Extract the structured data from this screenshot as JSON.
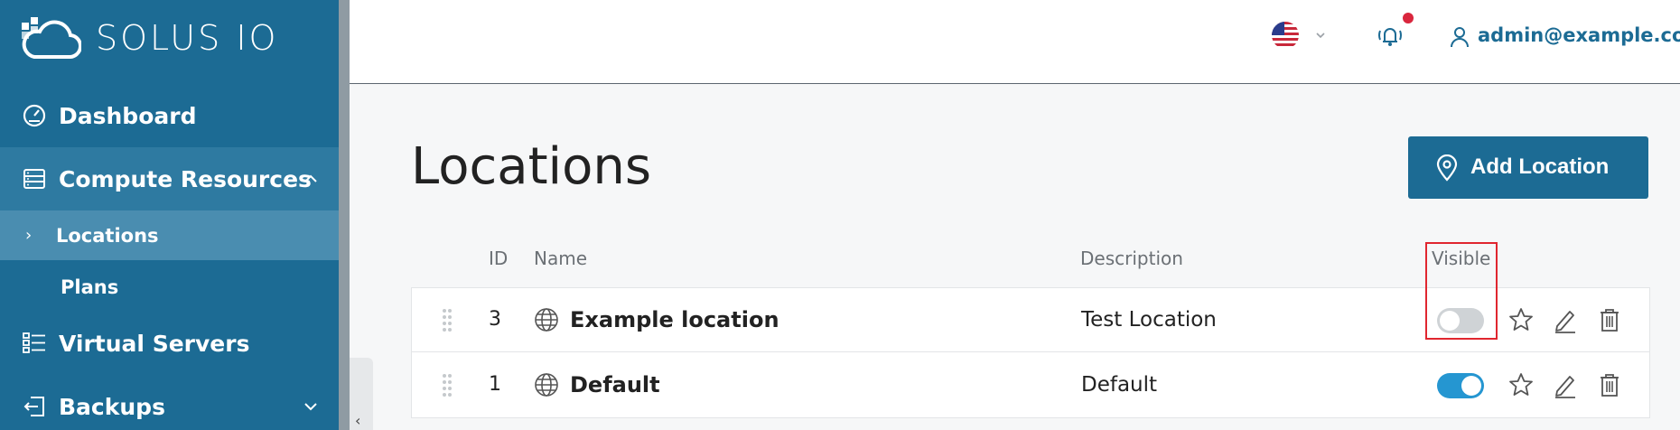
{
  "app": {
    "logo_text": "SOLUS IO"
  },
  "sidebar": {
    "items": [
      {
        "label": "Dashboard",
        "icon": "dashboard-icon"
      },
      {
        "label": "Compute Resources",
        "icon": "compute-resources-icon",
        "expanded": true
      },
      {
        "label": "Locations",
        "active": true
      },
      {
        "label": "Plans"
      },
      {
        "label": "Virtual Servers",
        "icon": "virtual-servers-icon"
      },
      {
        "label": "Backups",
        "icon": "backups-icon",
        "expanded": false
      }
    ]
  },
  "header": {
    "language_icon": "us-flag-icon",
    "user_email": "admin@example.com",
    "has_notification": true
  },
  "main": {
    "title": "Locations",
    "add_button_label": "Add Location",
    "table": {
      "columns": {
        "id": "ID",
        "name": "Name",
        "description": "Description",
        "visible": "Visible"
      },
      "rows": [
        {
          "id": "3",
          "name": "Example location",
          "description": "Test Location",
          "visible": false
        },
        {
          "id": "1",
          "name": "Default",
          "description": "Default",
          "visible": true
        }
      ]
    }
  },
  "colors": {
    "sidebar": "#1c6b94",
    "accent": "#1c6b94",
    "toggle_on": "#2596d1",
    "notification_dot": "#d9263d",
    "highlight": "#e0262f"
  }
}
